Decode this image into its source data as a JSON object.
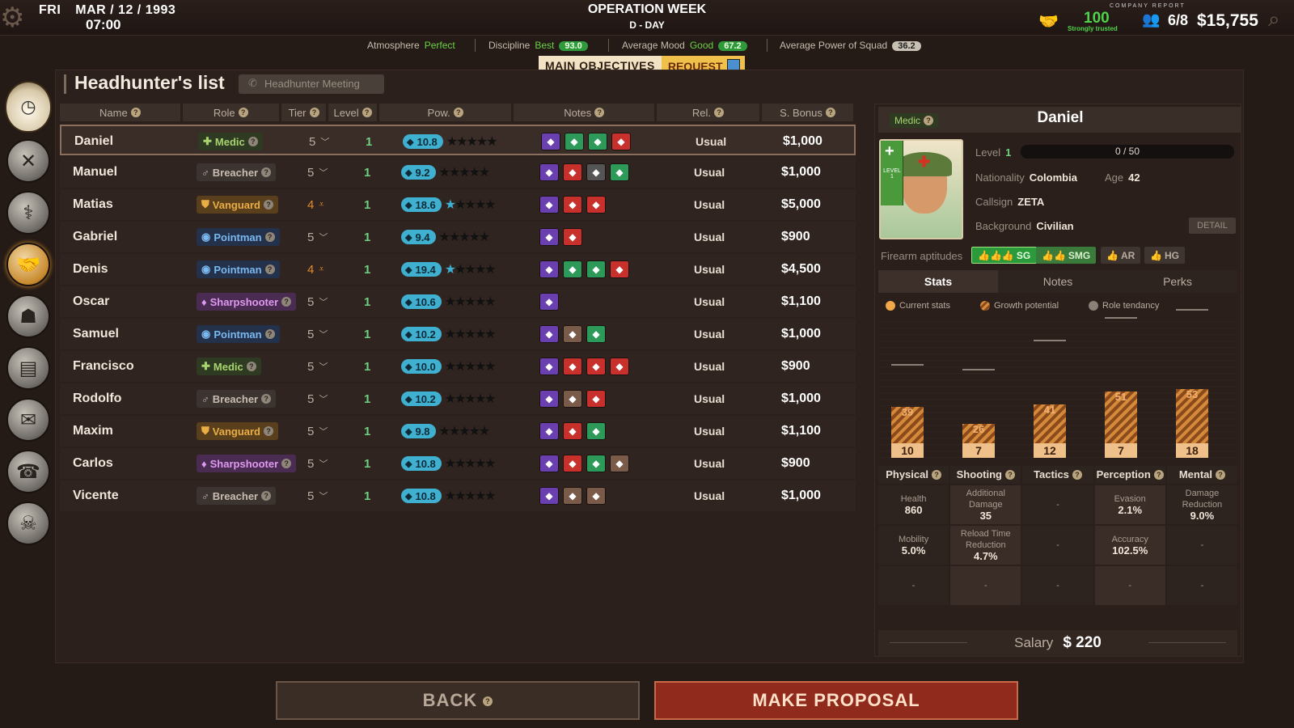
{
  "header": {
    "day": "FRI",
    "date": "MAR / 12 / 1993",
    "time": "07:00",
    "title": "OPERATION WEEK",
    "subtitle": "D - DAY",
    "report_label": "COMPANY REPORT",
    "trust_value": "100",
    "trust_text": "Strongly trusted",
    "hr_value": "6/8",
    "money": "$15,755"
  },
  "status": {
    "atmosphere_label": "Atmosphere",
    "atmosphere_value": "Perfect",
    "discipline_label": "Discipline",
    "discipline_value": "Best",
    "discipline_score": "93.0",
    "mood_label": "Average Mood",
    "mood_value": "Good",
    "mood_score": "67.2",
    "power_label": "Average Power of Squad",
    "power_score": "36.2"
  },
  "top_tabs": {
    "main_objectives": "MAIN OBJECTIVES",
    "request": "REQUEST"
  },
  "list": {
    "title": "Headhunter's list",
    "meeting_button": "Headhunter Meeting",
    "columns": [
      "Name",
      "Role",
      "Tier",
      "Level",
      "Pow.",
      "Notes",
      "Rel.",
      "S. Bonus"
    ],
    "rows": [
      {
        "name": "Daniel",
        "role": "Medic",
        "tier": "5",
        "level": "1",
        "pow": "10.8",
        "rel": "Usual",
        "bonus": "$1,000"
      },
      {
        "name": "Manuel",
        "role": "Breacher",
        "tier": "5",
        "level": "1",
        "pow": "9.2",
        "rel": "Usual",
        "bonus": "$1,000"
      },
      {
        "name": "Matias",
        "role": "Vanguard",
        "tier": "4",
        "level": "1",
        "pow": "18.6",
        "rel": "Usual",
        "bonus": "$5,000"
      },
      {
        "name": "Gabriel",
        "role": "Pointman",
        "tier": "5",
        "level": "1",
        "pow": "9.4",
        "rel": "Usual",
        "bonus": "$900"
      },
      {
        "name": "Denis",
        "role": "Pointman",
        "tier": "4",
        "level": "1",
        "pow": "19.4",
        "rel": "Usual",
        "bonus": "$4,500"
      },
      {
        "name": "Oscar",
        "role": "Sharpshooter",
        "tier": "5",
        "level": "1",
        "pow": "10.6",
        "rel": "Usual",
        "bonus": "$1,100"
      },
      {
        "name": "Samuel",
        "role": "Pointman",
        "tier": "5",
        "level": "1",
        "pow": "10.2",
        "rel": "Usual",
        "bonus": "$1,000"
      },
      {
        "name": "Francisco",
        "role": "Medic",
        "tier": "5",
        "level": "1",
        "pow": "10.0",
        "rel": "Usual",
        "bonus": "$900"
      },
      {
        "name": "Rodolfo",
        "role": "Breacher",
        "tier": "5",
        "level": "1",
        "pow": "10.2",
        "rel": "Usual",
        "bonus": "$1,000"
      },
      {
        "name": "Maxim",
        "role": "Vanguard",
        "tier": "5",
        "level": "1",
        "pow": "9.8",
        "rel": "Usual",
        "bonus": "$1,100"
      },
      {
        "name": "Carlos",
        "role": "Sharpshooter",
        "tier": "5",
        "level": "1",
        "pow": "10.8",
        "rel": "Usual",
        "bonus": "$900"
      },
      {
        "name": "Vicente",
        "role": "Breacher",
        "tier": "5",
        "level": "1",
        "pow": "10.8",
        "rel": "Usual",
        "bonus": "$1,000"
      }
    ]
  },
  "detail": {
    "role": "Medic",
    "name": "Daniel",
    "level_tag": "LEVEL 1",
    "level_label": "Level",
    "level": "1",
    "xp": "0 / 50",
    "nationality_label": "Nationality",
    "nationality": "Colombia",
    "age_label": "Age",
    "age": "42",
    "callsign_label": "Callsign",
    "callsign": "ZETA",
    "background_label": "Background",
    "background": "Civilian",
    "detail_button": "DETAIL",
    "firearm_label": "Firearm aptitudes",
    "firearms": [
      "SG",
      "SMG",
      "AR",
      "HG"
    ],
    "tabs": [
      "Stats",
      "Notes",
      "Perks"
    ],
    "legend": [
      "Current stats",
      "Growth potential",
      "Role tendancy"
    ],
    "stats": [
      {
        "name": "Physical",
        "current": "10",
        "potential": "39"
      },
      {
        "name": "Shooting",
        "current": "7",
        "potential": "26"
      },
      {
        "name": "Tactics",
        "current": "12",
        "potential": "41"
      },
      {
        "name": "Perception",
        "current": "7",
        "potential": "51"
      },
      {
        "name": "Mental",
        "current": "18",
        "potential": "53"
      }
    ],
    "substats": {
      "physical": [
        [
          "Health",
          "860"
        ],
        [
          "Mobility",
          "5.0%"
        ],
        [
          "-",
          ""
        ]
      ],
      "shooting": [
        [
          "Additional Damage",
          "35"
        ],
        [
          "Reload Time Reduction",
          "4.7%"
        ],
        [
          "-",
          ""
        ]
      ],
      "tactics": [
        [
          "-",
          ""
        ],
        [
          "-",
          ""
        ],
        [
          "-",
          ""
        ]
      ],
      "perception": [
        [
          "Evasion",
          "2.1%"
        ],
        [
          "Accuracy",
          "102.5%"
        ],
        [
          "-",
          ""
        ]
      ],
      "mental": [
        [
          "Damage Reduction",
          "9.0%"
        ],
        [
          "-",
          ""
        ],
        [
          "-",
          ""
        ]
      ]
    },
    "salary_label": "Salary",
    "salary": "$ 220"
  },
  "buttons": {
    "back": "BACK",
    "proposal": "MAKE PROPOSAL"
  },
  "colors": {
    "accent_pow": "#3fb0d0",
    "proposal_red": "#8f2a1c",
    "positive_green": "#4fd34a"
  }
}
